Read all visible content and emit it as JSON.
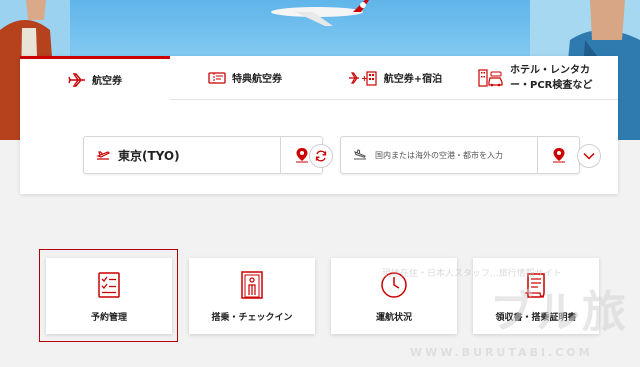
{
  "tabs": [
    {
      "label": "航空券",
      "icon": "plane-icon",
      "active": true
    },
    {
      "label": "特典航空券",
      "icon": "ticket-icon",
      "active": false
    },
    {
      "label": "航空券+宿泊",
      "icon": "plane-hotel-icon",
      "active": false
    },
    {
      "label": "ホテル・レンタカー・PCR検査など",
      "label_line1": "ホテル・レンタカ",
      "label_line2": "ー・PCR検査など",
      "icon": "hotel-car-icon",
      "active": false
    }
  ],
  "search": {
    "from_value": "東京(TYO)",
    "to_placeholder": "国内または海外の空港・都市を入力"
  },
  "quick_links": [
    {
      "label": "予約管理",
      "icon": "checklist-icon"
    },
    {
      "label": "搭乗・チェックイン",
      "icon": "boarding-gate-icon"
    },
    {
      "label": "運航状況",
      "icon": "clock-icon"
    },
    {
      "label": "領収書・搭乗証明書",
      "icon": "receipt-icon"
    }
  ],
  "watermark": {
    "line": "現地在住・日本人スタッフ...旅行情報サイト",
    "brand": "ブル旅",
    "url": "WWW.BURUTABI.COM"
  },
  "colors": {
    "accent": "#cc0000",
    "panel": "#ffffff",
    "sky": "#8fd0f4"
  }
}
